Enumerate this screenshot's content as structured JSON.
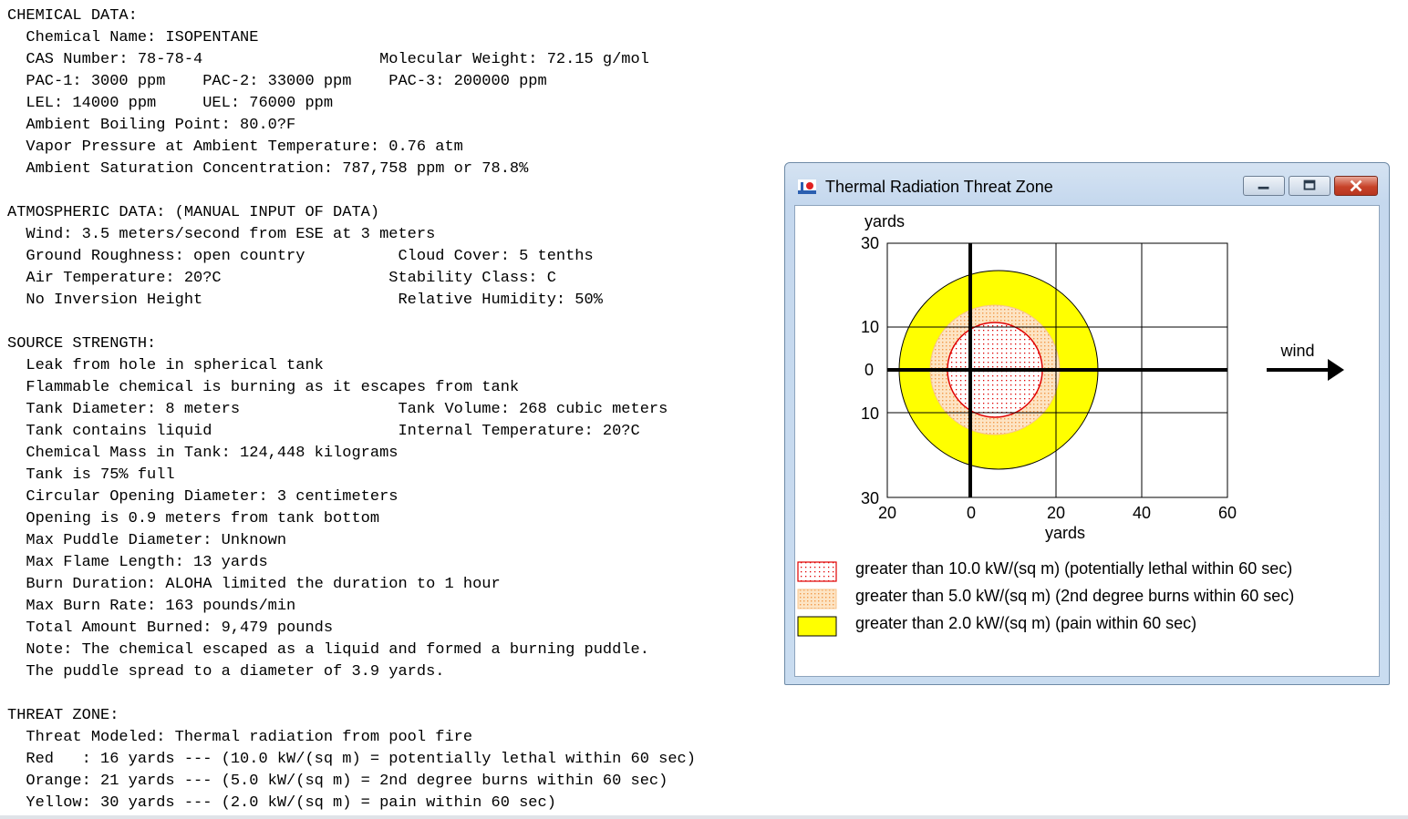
{
  "report": {
    "lines": [
      "CHEMICAL DATA:",
      "  Chemical Name: ISOPENTANE",
      "  CAS Number: 78-78-4                   Molecular Weight: 72.15 g/mol",
      "  PAC-1: 3000 ppm    PAC-2: 33000 ppm    PAC-3: 200000 ppm",
      "  LEL: 14000 ppm     UEL: 76000 ppm",
      "  Ambient Boiling Point: 80.0?F",
      "  Vapor Pressure at Ambient Temperature: 0.76 atm",
      "  Ambient Saturation Concentration: 787,758 ppm or 78.8%",
      "",
      "ATMOSPHERIC DATA: (MANUAL INPUT OF DATA)",
      "  Wind: 3.5 meters/second from ESE at 3 meters",
      "  Ground Roughness: open country          Cloud Cover: 5 tenths",
      "  Air Temperature: 20?C                  Stability Class: C",
      "  No Inversion Height                     Relative Humidity: 50%",
      "",
      "SOURCE STRENGTH:",
      "  Leak from hole in spherical tank",
      "  Flammable chemical is burning as it escapes from tank",
      "  Tank Diameter: 8 meters                 Tank Volume: 268 cubic meters",
      "  Tank contains liquid                    Internal Temperature: 20?C",
      "  Chemical Mass in Tank: 124,448 kilograms",
      "  Tank is 75% full",
      "  Circular Opening Diameter: 3 centimeters",
      "  Opening is 0.9 meters from tank bottom",
      "  Max Puddle Diameter: Unknown",
      "  Max Flame Length: 13 yards",
      "  Burn Duration: ALOHA limited the duration to 1 hour",
      "  Max Burn Rate: 163 pounds/min",
      "  Total Amount Burned: 9,479 pounds",
      "  Note: The chemical escaped as a liquid and formed a burning puddle.",
      "  The puddle spread to a diameter of 3.9 yards.",
      "",
      "THREAT ZONE:",
      "  Threat Modeled: Thermal radiation from pool fire",
      "  Red   : 16 yards --- (10.0 kW/(sq m) = potentially lethal within 60 sec)",
      "  Orange: 21 yards --- (5.0 kW/(sq m) = 2nd degree burns within 60 sec)",
      "  Yellow: 30 yards --- (2.0 kW/(sq m) = pain within 60 sec)"
    ]
  },
  "window": {
    "title": "Thermal Radiation Threat Zone",
    "icon": "aloha-app-icon",
    "buttons": {
      "minimize": "minimize-icon",
      "maximize": "maximize-icon",
      "close": "close-icon"
    }
  },
  "plot": {
    "y_unit": "yards",
    "x_unit": "yards",
    "y_ticks": [
      "30",
      "10",
      "0",
      "10",
      "30"
    ],
    "x_ticks": [
      "20",
      "0",
      "20",
      "40",
      "60"
    ],
    "wind_label": "wind"
  },
  "legend": [
    {
      "text": "greater than 10.0 kW/(sq m) (potentially lethal within 60 sec)",
      "color": "#ff0000"
    },
    {
      "text": "greater than 5.0 kW/(sq m) (2nd degree burns within 60 sec)",
      "color": "#ffa040"
    },
    {
      "text": "greater than 2.0 kW/(sq m) (pain within 60 sec)",
      "color": "#ffff00"
    }
  ],
  "colors": {
    "red_zone": "#ff0000",
    "orange_zone": "#fcd2a4",
    "yellow_zone": "#ffff00"
  }
}
